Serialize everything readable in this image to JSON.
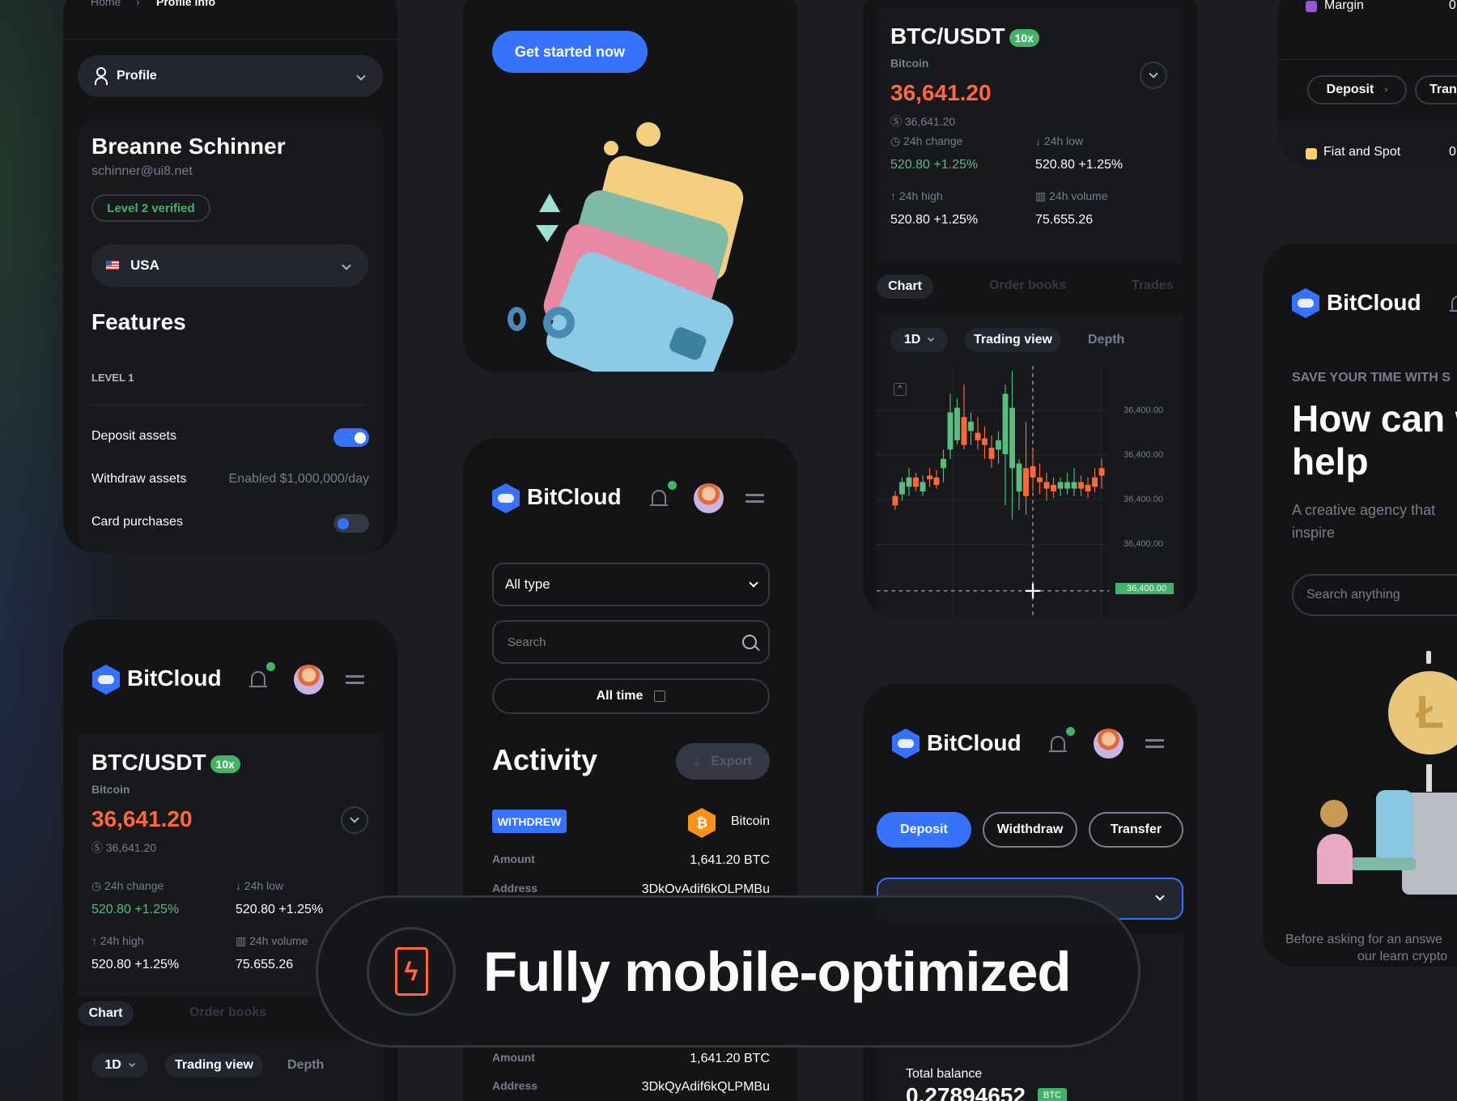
{
  "brand": "BitCloud",
  "colors": {
    "accent": "#3772ff",
    "positive": "#45b26b",
    "negative": "#ff6838",
    "background": "#141416"
  },
  "profile_card": {
    "breadcrumb": [
      "Home",
      "Profile info"
    ],
    "menu_select": "Profile",
    "name": "Breanne Schinner",
    "email": "schinner@ui8.net",
    "level_badge": "Level 2 verified",
    "country": "USA",
    "features_title": "Features",
    "level_label": "LEVEL 1",
    "features": [
      {
        "label": "Deposit assets",
        "toggle": true
      },
      {
        "label": "Withdraw assets",
        "value": "Enabled $1,000,000/day"
      },
      {
        "label": "Card purchases",
        "toggle": false
      }
    ]
  },
  "market": {
    "pair": "BTC/USDT",
    "leverage": "10x",
    "coin": "Bitcoin",
    "price": "36,641.20",
    "price_usd": "36,641.20",
    "stats": [
      {
        "label": "24h change",
        "value": "520.80 +1.25%",
        "icon": "clock-icon",
        "positive": true
      },
      {
        "label": "24h low",
        "value": "520.80 +1.25%",
        "icon": "arrow-down-icon"
      },
      {
        "label": "24h high",
        "value": "520.80 +1.25%",
        "icon": "arrow-up-icon"
      },
      {
        "label": "24h volume",
        "value": "75.655.26",
        "icon": "bar-chart-icon"
      }
    ],
    "tabs": [
      "Chart",
      "Order books",
      "Trades"
    ],
    "interval": "1D",
    "views": [
      "Trading view",
      "Depth"
    ],
    "y_ticks": [
      "36,400.00",
      "36,400.00",
      "36,400.00",
      "36,400.00"
    ],
    "current_price_label": "36,400.00"
  },
  "hero_card": {
    "cta": "Get started now"
  },
  "activity_card": {
    "type_select": "All type",
    "search_placeholder": "Search",
    "time_filter": "All time",
    "title": "Activity",
    "export": "Export",
    "transaction": {
      "type": "WITHDREW",
      "coin": "Bitcoin",
      "amount_label": "Amount",
      "amount": "1,641.20 BTC",
      "address_label": "Address",
      "address": "3DkOvAdif6kOLPMBu"
    },
    "transaction2": {
      "amount_label": "Amount",
      "amount": "1,641.20 BTC",
      "address_label": "Address",
      "address": "3DkQyAdif6kQLPMBu"
    }
  },
  "wallet_card": {
    "actions": [
      "Deposit",
      "Widthdraw",
      "Transfer"
    ],
    "balance_label": "Total balance",
    "balance": "0.27894652",
    "balance_unit": "BTC"
  },
  "margin_card": {
    "rows": [
      {
        "label": "Margin",
        "value": "0",
        "color": "#9757d7"
      },
      {
        "label": "Fiat and Spot",
        "value": "0",
        "color": "#ffd166"
      }
    ],
    "actions": [
      "Deposit",
      "Trans"
    ]
  },
  "help_card": {
    "eyebrow": "SAVE YOUR TIME WITH S",
    "title_line1": "How can w",
    "title_line2": "help",
    "desc_line1": "A creative agency that",
    "desc_line2": "inspire",
    "search_placeholder": "Search anything",
    "footer_line1": "Before asking for an answe",
    "footer_line2": "our learn crypto"
  },
  "overlay": {
    "headline": "Fully mobile-optimized",
    "icon": "lightning-phone-icon"
  }
}
